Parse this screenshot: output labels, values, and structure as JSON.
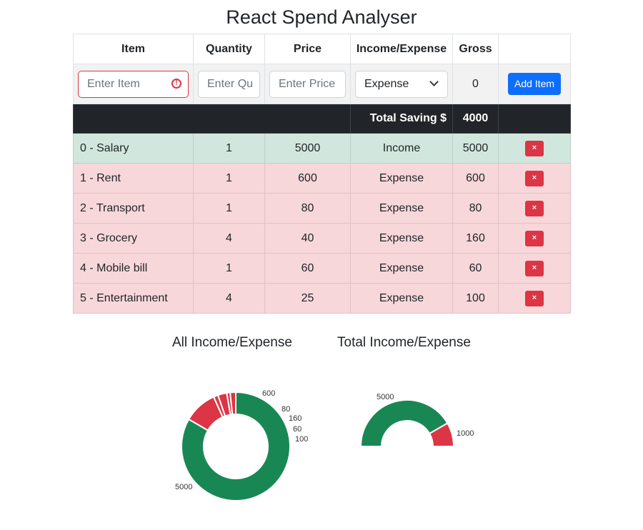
{
  "title": "React Spend Analyser",
  "table": {
    "headers": [
      "Item",
      "Quantity",
      "Price",
      "Income/Expense",
      "Gross",
      ""
    ],
    "form": {
      "item_placeholder": "Enter Item",
      "quantity_placeholder": "Enter Qu",
      "price_placeholder": "Enter Price",
      "type_value": "Expense",
      "gross": "0",
      "add_label": "Add Item"
    },
    "total": {
      "label": "Total Saving $",
      "value": "4000"
    },
    "rows": [
      {
        "item": "0 - Salary",
        "qty": "1",
        "price": "5000",
        "type": "Income",
        "gross": "5000",
        "delete": "×"
      },
      {
        "item": "1 - Rent",
        "qty": "1",
        "price": "600",
        "type": "Expense",
        "gross": "600",
        "delete": "×"
      },
      {
        "item": "2 - Transport",
        "qty": "1",
        "price": "80",
        "type": "Expense",
        "gross": "80",
        "delete": "×"
      },
      {
        "item": "3 - Grocery",
        "qty": "4",
        "price": "40",
        "type": "Expense",
        "gross": "160",
        "delete": "×"
      },
      {
        "item": "4 - Mobile bill",
        "qty": "1",
        "price": "60",
        "type": "Expense",
        "gross": "60",
        "delete": "×"
      },
      {
        "item": "5 - Entertainment",
        "qty": "4",
        "price": "25",
        "type": "Expense",
        "gross": "100",
        "delete": "×"
      }
    ]
  },
  "colors": {
    "income": "#198754",
    "expense": "#dc3545",
    "accent": "#0d6efd"
  },
  "chart_data": [
    {
      "type": "pie",
      "title": "All Income/Expense",
      "values": [
        5000,
        600,
        80,
        160,
        60,
        100
      ],
      "labels": [
        "5000",
        "600",
        "80",
        "160",
        "60",
        "100"
      ],
      "colors": [
        "#198754",
        "#dc3545",
        "#dc3545",
        "#dc3545",
        "#dc3545",
        "#dc3545"
      ]
    },
    {
      "type": "pie",
      "title": "Total Income/Expense",
      "values": [
        5000,
        1000
      ],
      "labels": [
        "5000",
        "1000"
      ],
      "colors": [
        "#198754",
        "#dc3545"
      ]
    }
  ]
}
